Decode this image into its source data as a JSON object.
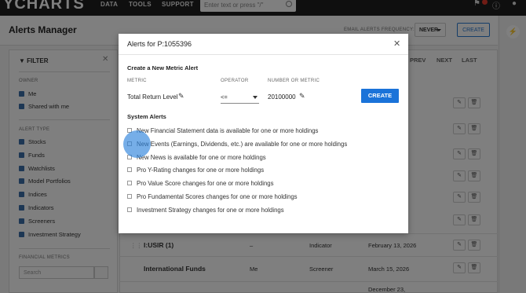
{
  "topnav": {
    "logo": "YCHARTS",
    "links": [
      "DATA",
      "TOOLS",
      "SUPPORT"
    ],
    "search_placeholder": "Enter text or press \"/\""
  },
  "header": {
    "title": "Alerts Manager",
    "frequency_label": "EMAIL ALERTS FREQUENCY:",
    "frequency_value": "NEVER",
    "create_label": "CREATE"
  },
  "sidebar": {
    "title": "FILTER",
    "owner_label": "OWNER",
    "owner_options": [
      "Me",
      "Shared with me"
    ],
    "alert_type_label": "ALERT TYPE",
    "alert_types": [
      "Stocks",
      "Funds",
      "Watchlists",
      "Model Portfolios",
      "Indices",
      "Indicators",
      "Screeners",
      "Investment Strategy"
    ],
    "metrics_label": "FINANCIAL METRICS",
    "search_placeholder": "Search"
  },
  "pager": [
    "PREV",
    "NEXT",
    "LAST"
  ],
  "rows": [
    {
      "name": "I:USIR (1)",
      "owner": "–",
      "type": "Indicator",
      "date": "February 13, 2026"
    },
    {
      "name": "International Funds",
      "owner": "Me",
      "type": "Screener",
      "date": "March 15, 2026"
    },
    {
      "name": "",
      "owner": "",
      "type": "",
      "date": "December 23,"
    }
  ],
  "modal": {
    "title": "Alerts for P:1055396",
    "section_metric": "Create a New Metric Alert",
    "metric_label": "METRIC",
    "operator_label": "OPERATOR",
    "number_label": "NUMBER OR METRIC",
    "metric_value": "Total Return Level",
    "operator_value": "<=",
    "number_value": "20100000",
    "create_label": "CREATE",
    "section_system": "System Alerts",
    "system_alerts": [
      "New Financial Statement data is available for one or more holdings",
      "New Events (Earnings, Dividends, etc.) are available for one or more holdings",
      "New News is available for one or more holdings",
      "Pro Y-Rating changes for one or more holdings",
      "Pro Value Score changes for one or more holdings",
      "Pro Fundamental Scores changes for one or more holdings",
      "Investment Strategy changes for one or more holdings"
    ]
  },
  "colors": {
    "accent": "#1a73d9",
    "nav_bg": "#1f1f1f",
    "checkbox": "#3a6ea8"
  }
}
